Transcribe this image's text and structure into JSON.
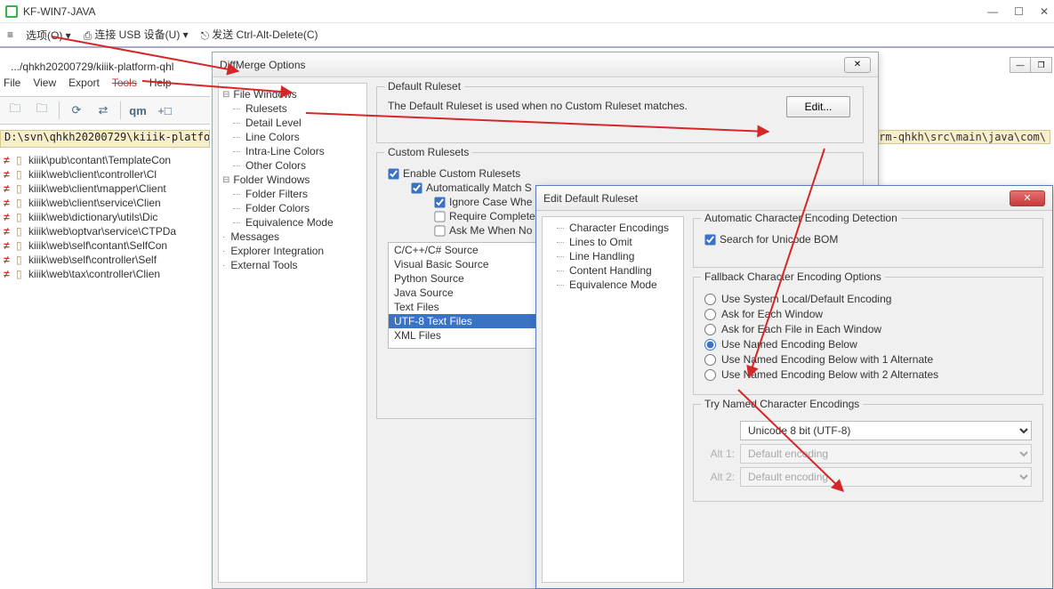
{
  "vm": {
    "title": "KF-WIN7-JAVA",
    "toolbar": {
      "options": "选项(O)",
      "usb": "连接 USB 设备(U)",
      "send_cad": "发送 Ctrl-Alt-Delete(C)"
    }
  },
  "dm": {
    "tab_path": ".../qhkh20200729/kiiik-platform-qhl",
    "menu": {
      "file": "File",
      "view": "View",
      "export": "Export",
      "tools": "Tools",
      "help": "Help"
    },
    "path_left": "D:\\svn\\qhkh20200729\\kiiik-platfo",
    "right_hint": "form-qhkh\\src\\main\\java\\com\\",
    "files": [
      "kiiik\\pub\\contant\\TemplateCon",
      "kiiik\\web\\client\\controller\\Cl",
      "kiiik\\web\\client\\mapper\\Client",
      "kiiik\\web\\client\\service\\Clien",
      "kiiik\\web\\dictionary\\utils\\Dic",
      "kiiik\\web\\optvar\\service\\CTPDa",
      "kiiik\\web\\self\\contant\\SelfCon",
      "kiiik\\web\\self\\controller\\Self",
      "kiiik\\web\\tax\\controller\\Clien"
    ]
  },
  "opt": {
    "title": "DiffMerge Options",
    "tree": {
      "file_windows": "File Windows",
      "rulesets": "Rulesets",
      "detail_level": "Detail Level",
      "line_colors": "Line Colors",
      "intra_line_colors": "Intra-Line Colors",
      "other_colors": "Other Colors",
      "folder_windows": "Folder Windows",
      "folder_filters": "Folder Filters",
      "folder_colors": "Folder Colors",
      "equivalence_mode": "Equivalence Mode",
      "messages": "Messages",
      "explorer_integration": "Explorer Integration",
      "external_tools": "External Tools"
    },
    "default_ruleset": {
      "title": "Default Ruleset",
      "text": "The Default Ruleset is used when no Custom Ruleset matches.",
      "edit": "Edit..."
    },
    "custom": {
      "title": "Custom Rulesets",
      "enable": "Enable Custom Rulesets",
      "auto_match": "Automatically Match S",
      "ignore_case": "Ignore Case Whe",
      "require_complete": "Require Complete",
      "ask_me": "Ask Me When No",
      "list": [
        "C/C++/C# Source",
        "Visual Basic Source",
        "Python Source",
        "Java Source",
        "Text Files",
        "UTF-8 Text Files",
        "XML Files"
      ],
      "selected": 5
    }
  },
  "edr": {
    "title": "Edit Default Ruleset",
    "tree": {
      "char_enc": "Character Encodings",
      "lines_omit": "Lines to Omit",
      "line_handling": "Line Handling",
      "content_handling": "Content Handling",
      "equiv_mode": "Equivalence Mode"
    },
    "auto_group": {
      "title": "Automatic Character Encoding Detection",
      "bom": "Search for Unicode BOM"
    },
    "fallback": {
      "title": "Fallback Character Encoding Options",
      "r0": "Use System Local/Default Encoding",
      "r1": "Ask for Each Window",
      "r2": "Ask for Each File in Each Window",
      "r3": "Use Named Encoding Below",
      "r4": "Use Named Encoding Below with 1 Alternate",
      "r5": "Use Named Encoding Below with 2 Alternates"
    },
    "try_named": {
      "title": "Try Named Character Encodings",
      "main": "Unicode 8 bit (UTF-8)",
      "alt1_lbl": "Alt 1:",
      "alt2_lbl": "Alt 2:",
      "alt_default": "Default encoding"
    }
  }
}
